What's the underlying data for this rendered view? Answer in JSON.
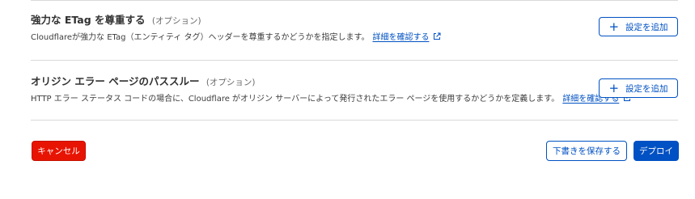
{
  "settings": [
    {
      "title": "強力な ETag を尊重する",
      "optional": "(オプション)",
      "description": "Cloudflareが強力な ETag（エンティティ タグ）ヘッダーを尊重するかどうかを指定します。",
      "link": "詳細を確認する",
      "button": "設定を追加"
    },
    {
      "title": "オリジン エラー ページのパススルー",
      "optional": "(オプション)",
      "description": "HTTP エラー ステータス コードの場合に、Cloudflare がオリジン サーバーによって発行されたエラー ページを使用するかどうかを定義します。",
      "link": "詳細を確認する",
      "button": "設定を追加"
    }
  ],
  "footer": {
    "cancel": "キャンセル",
    "save_draft": "下書きを保存する",
    "deploy": "デプロイ"
  },
  "colors": {
    "accent": "#0051c3",
    "danger": "#e81403",
    "divider": "#d9d9d9"
  },
  "icons": {
    "external_link": "external-link-icon",
    "plus": "plus-icon"
  }
}
